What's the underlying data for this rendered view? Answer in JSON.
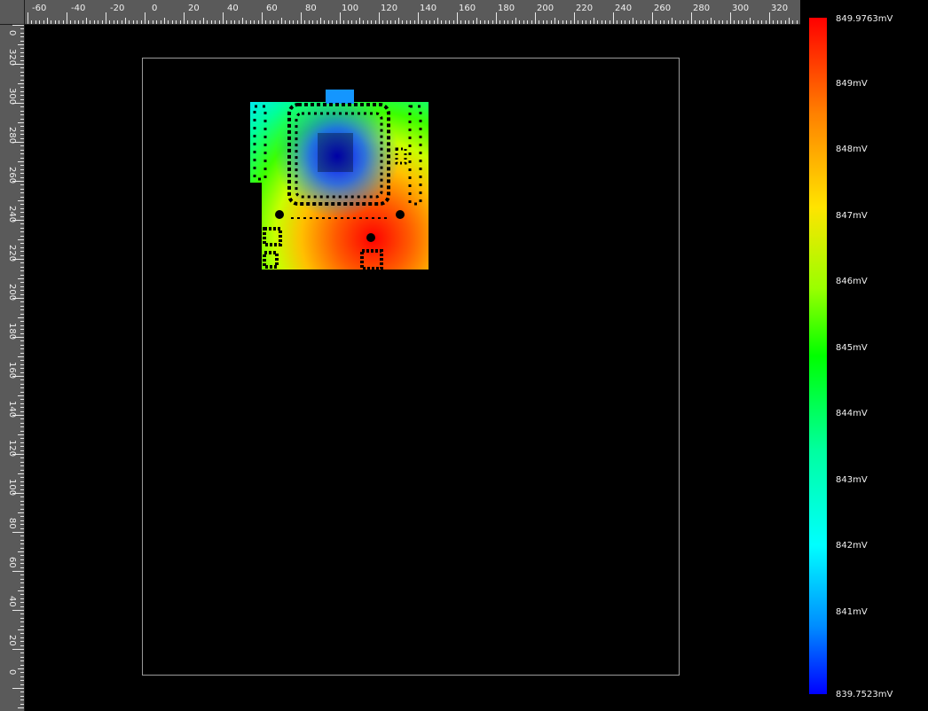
{
  "ruler": {
    "horizontal_ticks": [
      "-60",
      "-40",
      "-20",
      "0",
      "20",
      "40",
      "60",
      "80",
      "100",
      "120",
      "140",
      "160",
      "180",
      "200",
      "220",
      "240",
      "260",
      "280",
      "300",
      "320"
    ],
    "vertical_ticks": [
      "0",
      "320",
      "300",
      "280",
      "260",
      "240",
      "220",
      "200",
      "180",
      "160",
      "140",
      "120",
      "100",
      "80",
      "60",
      "40",
      "20",
      "0"
    ]
  },
  "legend": {
    "max_label": "849.9763mV",
    "min_label": "839.7523mV",
    "labels": [
      "849mV",
      "848mV",
      "847mV",
      "846mV",
      "845mV",
      "844mV",
      "843mV",
      "842mV",
      "841mV"
    ]
  },
  "colors": {
    "background": "#000000",
    "ruler_bg": "#5a5a5a",
    "outline": "#9a9a9a"
  },
  "icons": [
    "ruler-corner"
  ]
}
